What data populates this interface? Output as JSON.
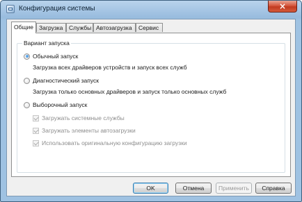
{
  "window": {
    "title": "Конфигурация системы",
    "close_glyph": "×"
  },
  "tabs": [
    {
      "label": "Общие",
      "active": true
    },
    {
      "label": "Загрузка",
      "active": false
    },
    {
      "label": "Службы",
      "active": false
    },
    {
      "label": "Автозагрузка",
      "active": false
    },
    {
      "label": "Сервис",
      "active": false
    }
  ],
  "startup": {
    "group_title": "Вариант запуска",
    "normal": {
      "label": "Обычный запуск",
      "desc": "Загрузка всех драйверов устройств и запуск всех служб",
      "selected": true
    },
    "diagnostic": {
      "label": "Диагностический запуск",
      "desc": "Загрузка только основных драйверов и запуск только основных служб",
      "selected": false
    },
    "selective": {
      "label": "Выборочный запуск",
      "selected": false,
      "options": [
        {
          "label": "Загружать системные службы",
          "checked": true,
          "enabled": false
        },
        {
          "label": "Загружать элементы автозагрузки",
          "checked": true,
          "enabled": false
        },
        {
          "label": "Использовать оригинальную конфигурацию загрузки",
          "checked": true,
          "enabled": false
        }
      ]
    }
  },
  "buttons": {
    "ok": "OK",
    "cancel": "Отмена",
    "apply": "Применить",
    "help": "Справка"
  }
}
